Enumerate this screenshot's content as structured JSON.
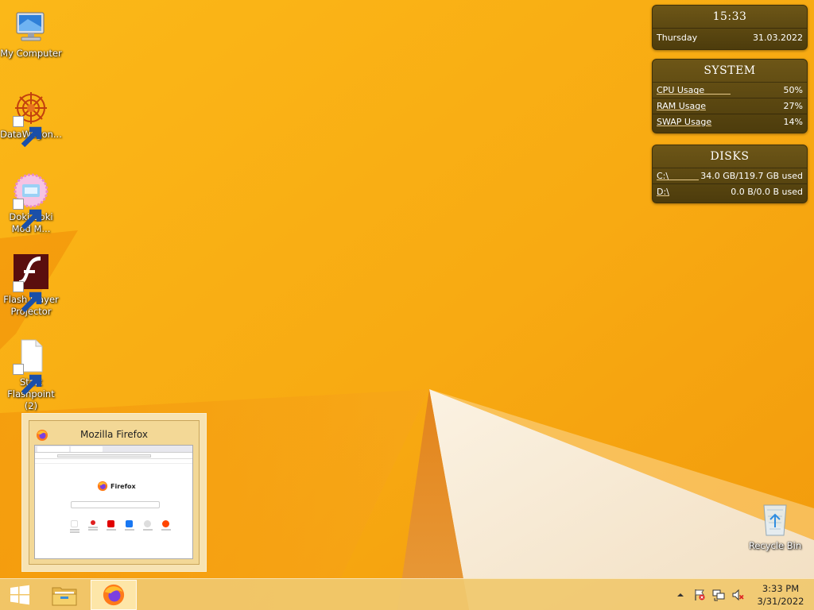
{
  "desktop": {
    "icons": [
      {
        "label": "My Computer",
        "icon": "computer-icon"
      },
      {
        "label": "DataWagon...",
        "icon": "datawagon-icon"
      },
      {
        "label": "Doki Doki Mod M...",
        "icon": "doki-doki-icon"
      },
      {
        "label": "Flash Player Projector",
        "icon": "flash-player-icon"
      },
      {
        "label": "Start Flashpoint (2)",
        "icon": "document-icon"
      },
      {
        "label": "Recycle Bin",
        "icon": "recycle-bin-icon"
      }
    ]
  },
  "gadgets": {
    "clock": {
      "time": "15:33",
      "day": "Thursday",
      "date": "31.03.2022"
    },
    "system": {
      "title": "SYSTEM",
      "rows": [
        {
          "label": "CPU Usage",
          "value": "50%",
          "fraction": 0.5
        },
        {
          "label": "RAM Usage",
          "value": "27%",
          "fraction": 0.27
        },
        {
          "label": "SWAP Usage",
          "value": "14%",
          "fraction": 0.14
        }
      ]
    },
    "disks": {
      "title": "DISKS",
      "rows": [
        {
          "label": "C:\\",
          "value": "34.0 GB/119.7 GB used",
          "fraction": 0.284
        },
        {
          "label": "D:\\",
          "value": "0.0 B/0.0 B used",
          "fraction": 0
        }
      ]
    }
  },
  "preview": {
    "title": "Mozilla Firefox",
    "brand": "Firefox"
  },
  "taskbar": {
    "apps": [
      {
        "name": "start",
        "icon": "windows-logo-icon"
      },
      {
        "name": "file-explorer",
        "icon": "folder-icon"
      },
      {
        "name": "firefox",
        "icon": "firefox-icon",
        "active": true
      }
    ],
    "tray": {
      "time": "3:33 PM",
      "date": "3/31/2022",
      "icons": [
        "chevron-up-icon",
        "action-center-flag-icon",
        "network-icon",
        "volume-muted-icon"
      ]
    }
  },
  "colors": {
    "wallpaper": "#f5a20c",
    "gadget_bg": "#5b4711",
    "gadget_accent": "#e7c98a",
    "taskbar": "#f0c86e"
  }
}
